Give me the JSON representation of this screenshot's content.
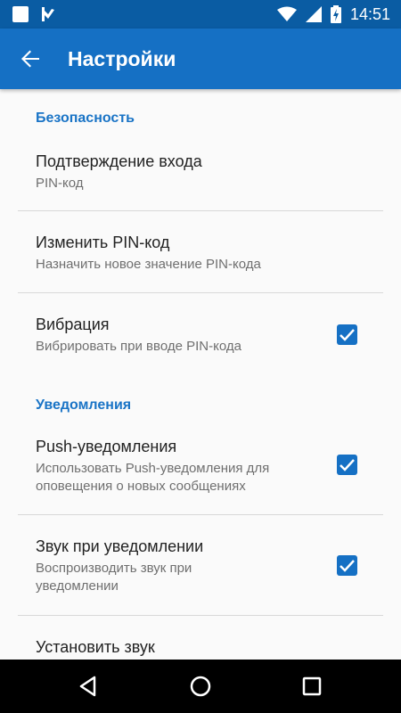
{
  "status_bar": {
    "time": "14:51",
    "icons": [
      "notification-square-icon",
      "flag-icon",
      "wifi-icon",
      "signal-icon",
      "battery-charging-icon"
    ]
  },
  "toolbar": {
    "title": "Настройки",
    "back_icon": "arrow-back-icon"
  },
  "sections": {
    "security": {
      "header": "Безопасность",
      "items": [
        {
          "title": "Подтверждение входа",
          "subtitle": "PIN-код"
        },
        {
          "title": "Изменить PIN-код",
          "subtitle": "Назначить новое значение PIN-кода"
        },
        {
          "title": "Вибрация",
          "subtitle": "Вибрировать при вводе PIN-кода",
          "checked": true
        }
      ]
    },
    "notifications": {
      "header": "Уведомления",
      "items": [
        {
          "title": "Push-уведомления",
          "subtitle": "Использовать Push-уведомления для оповещения о новых сообщениях",
          "checked": true
        },
        {
          "title": "Звук при уведомлении",
          "subtitle": "Воспроизводить звук при уведомлении",
          "checked": true
        },
        {
          "title": "Установить звук"
        }
      ]
    }
  },
  "nav_bar": {
    "icons": [
      "back-triangle-icon",
      "home-circle-icon",
      "recents-square-icon"
    ]
  },
  "colors": {
    "status_bar": "#0a5ca3",
    "toolbar": "#1570c4",
    "accent": "#1a74c6",
    "checkbox": "#1570c4"
  }
}
